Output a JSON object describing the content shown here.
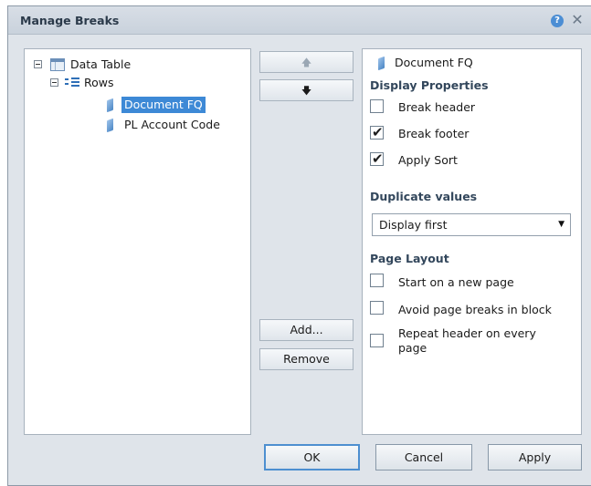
{
  "dialog": {
    "title": "Manage Breaks",
    "help_glyph": "?",
    "close_glyph": "✕"
  },
  "tree": {
    "root_label": "Data Table",
    "rows_label": "Rows",
    "items": [
      {
        "label": "Document FQ",
        "selected": true
      },
      {
        "label": "PL Account Code",
        "selected": false
      }
    ]
  },
  "middle_buttons": {
    "move_up": "🡅",
    "move_down": "🡇",
    "add": "Add...",
    "remove": "Remove"
  },
  "properties": {
    "header_label": "Document FQ",
    "display_properties_title": "Display Properties",
    "break_header": {
      "label": "Break header",
      "checked": false
    },
    "break_footer": {
      "label": "Break footer",
      "checked": true
    },
    "apply_sort": {
      "label": "Apply Sort",
      "checked": true
    },
    "duplicate_values_title": "Duplicate values",
    "duplicate_values_selected": "Display first",
    "page_layout_title": "Page Layout",
    "start_new_page": {
      "label": "Start on a new page",
      "checked": false
    },
    "avoid_breaks": {
      "label": "Avoid page breaks in block",
      "checked": false
    },
    "repeat_header_line1": "Repeat header on every",
    "repeat_header_line2": "page",
    "repeat_header_checked": false,
    "check_glyph": "✔"
  },
  "footer": {
    "ok": "OK",
    "cancel": "Cancel",
    "apply": "Apply"
  },
  "colors": {
    "selection": "#3d89d6",
    "dialog_bg": "#dfe4ea"
  }
}
